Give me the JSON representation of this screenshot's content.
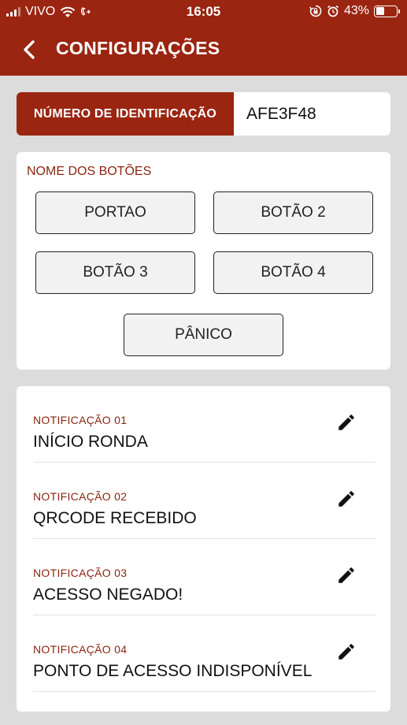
{
  "status_bar": {
    "carrier": "VIVO",
    "time": "16:05",
    "battery": "43%",
    "battery_level": 0.43,
    "icons": [
      "signal-icon",
      "wifi-icon",
      "call-forward-icon",
      "screen-rotation-lock-icon",
      "alarm-icon",
      "battery-icon"
    ]
  },
  "app_bar": {
    "title": "CONFIGURAÇÕES",
    "back_icon": "chevron-left-icon"
  },
  "identification": {
    "label": "NÚMERO DE IDENTIFICAÇÃO",
    "value": "AFE3F48"
  },
  "buttons_section": {
    "title": "NOME DOS BOTÕES",
    "buttons": [
      "PORTAO",
      "BOTÃO 2",
      "BOTÃO 3",
      "BOTÃO 4",
      "PÂNICO"
    ]
  },
  "notifications": [
    {
      "label": "NOTIFICAÇÃO 01",
      "value": "INÍCIO RONDA",
      "icon": "edit-icon"
    },
    {
      "label": "NOTIFICAÇÃO 02",
      "value": "QRCODE RECEBIDO",
      "icon": "edit-icon"
    },
    {
      "label": "NOTIFICAÇÃO 03",
      "value": "ACESSO NEGADO!",
      "icon": "edit-icon"
    },
    {
      "label": "NOTIFICAÇÃO 04",
      "value": "PONTO DE ACESSO INDISPONÍVEL",
      "icon": "edit-icon"
    }
  ],
  "colors": {
    "primary": "#9a2511",
    "accent_text": "#8a2510",
    "background": "#dcdcdc"
  }
}
